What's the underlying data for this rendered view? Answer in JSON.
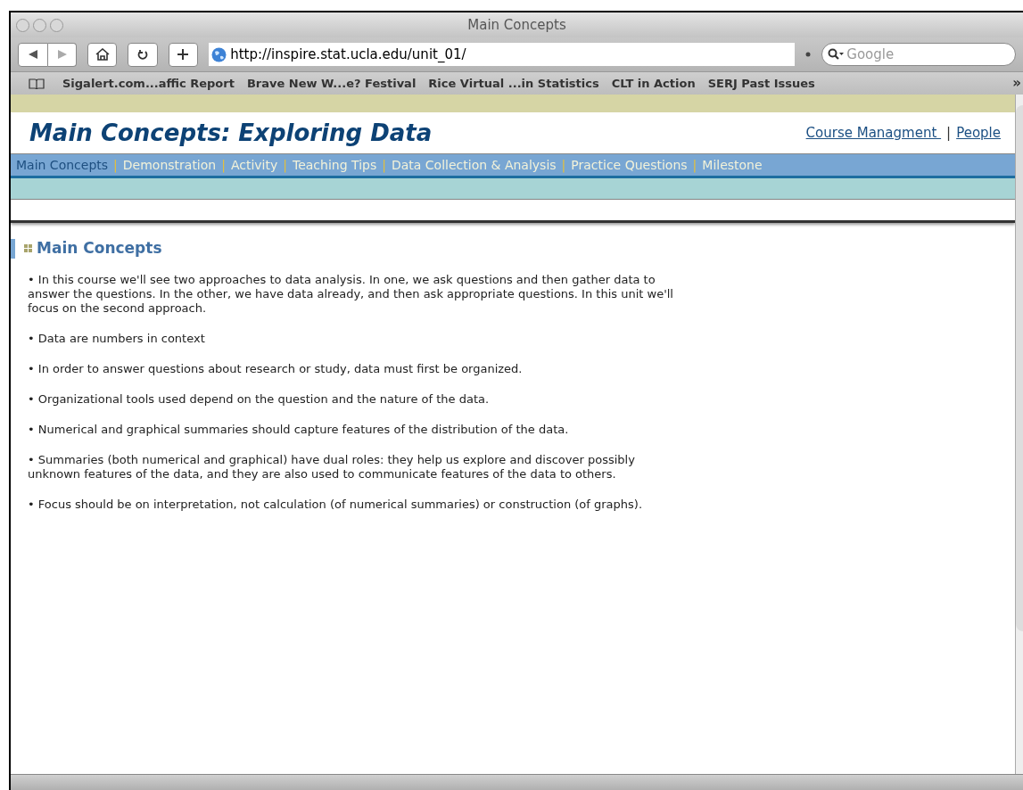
{
  "window": {
    "title": "Main Concepts"
  },
  "toolbar": {
    "url": "http://inspire.stat.ucla.edu/unit_01/",
    "search_placeholder": "Google"
  },
  "bookmarks": [
    "Sigalert.com...affic Report",
    "Brave New W...e? Festival",
    "Rice Virtual ...in Statistics",
    "CLT in Action",
    "SERJ Past Issues"
  ],
  "overflow": "»",
  "header": {
    "title": "Main Concepts: Exploring Data",
    "links": [
      "Course Managment ",
      "People"
    ],
    "separator": "|"
  },
  "nav": [
    {
      "label": "Main Concepts",
      "selected": true
    },
    {
      "label": "Demonstration",
      "selected": false
    },
    {
      "label": "Activity",
      "selected": false
    },
    {
      "label": "Teaching Tips",
      "selected": false
    },
    {
      "label": "Data Collection & Analysis",
      "selected": false
    },
    {
      "label": "Practice Questions",
      "selected": false
    },
    {
      "label": "Milestone",
      "selected": false
    }
  ],
  "section": {
    "heading": "Main Concepts",
    "paragraphs": [
      "• In this course we'll see two approaches to data analysis. In one, we ask questions and then gather data to answer the questions. In the other, we have data already, and then ask appropriate questions. In this unit we'll focus on the second approach.",
      "• Data are numbers in context",
      "• In order to answer questions about research or study, data must first be organized.",
      "• Organizational tools used depend on the question and the nature of the data.",
      "• Numerical and graphical summaries should capture features of the distribution of the data.",
      "• Summaries (both numerical and graphical) have dual roles: they help us explore and discover possibly unknown features of the data, and they are also used to communicate features of the data to others.",
      "• Focus should be on interpretation, not calculation (of numerical summaries) or construction (of graphs)."
    ]
  }
}
